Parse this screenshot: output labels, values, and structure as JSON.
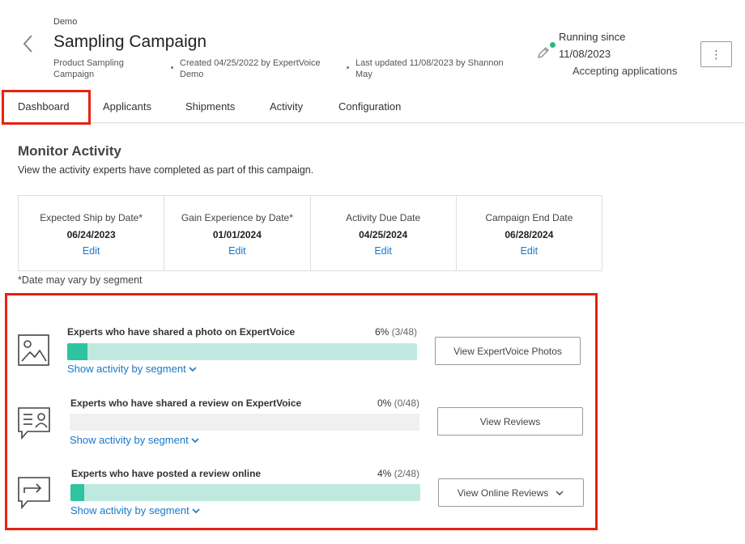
{
  "header": {
    "org": "Demo",
    "title": "Sampling Campaign",
    "campaign_type": "Product Sampling Campaign",
    "created": "Created 04/25/2022 by ExpertVoice Demo",
    "updated": "Last updated 11/08/2023 by Shannon May",
    "status_line1": "Running since",
    "status_line2": "11/08/2023",
    "status_line3": "Accepting applications",
    "status_color": "#2db87a",
    "kebab_icon": "⋮"
  },
  "tabs": [
    {
      "label": "Dashboard",
      "active": true
    },
    {
      "label": "Applicants"
    },
    {
      "label": "Shipments"
    },
    {
      "label": "Activity"
    },
    {
      "label": "Configuration"
    }
  ],
  "monitor": {
    "title": "Monitor Activity",
    "subtitle": "View the activity experts have completed as part of this campaign."
  },
  "dates": [
    {
      "label": "Expected Ship by Date*",
      "value": "06/24/2023",
      "edit": "Edit"
    },
    {
      "label": "Gain Experience by Date*",
      "value": "01/01/2024",
      "edit": "Edit"
    },
    {
      "label": "Activity Due Date",
      "value": "04/25/2024",
      "edit": "Edit"
    },
    {
      "label": "Campaign End Date",
      "value": "06/28/2024",
      "edit": "Edit"
    }
  ],
  "date_note": "*Date may vary by segment",
  "activities": [
    {
      "icon": "photo-icon",
      "label": "Experts who have shared a photo on ExpertVoice",
      "percent": "6%",
      "fraction": "(3/48)",
      "progress": 0.06,
      "link": "Show activity by segment",
      "button": "View ExpertVoice Photos",
      "track_color": "#bfe9df"
    },
    {
      "icon": "review-icon",
      "label": "Experts who have shared a review on ExpertVoice",
      "percent": "0%",
      "fraction": "(0/48)",
      "progress": 0,
      "link": "Show activity by segment",
      "button": "View Reviews",
      "track_color": "#f0f0f0"
    },
    {
      "icon": "share-review-icon",
      "label": "Experts who have posted a review online",
      "percent": "4%",
      "fraction": "(2/48)",
      "progress": 0.04,
      "link": "Show activity by segment",
      "button": "View Online Reviews",
      "track_color": "#bfe9df"
    }
  ],
  "colors": {
    "accent": "#1878c9",
    "progress_fill": "#2ec4a0",
    "highlight": "#e8210f"
  }
}
